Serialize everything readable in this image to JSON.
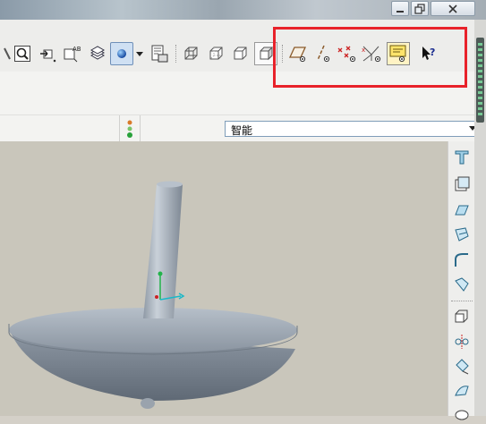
{
  "window": {
    "title": "",
    "controls": [
      "minimize",
      "restore",
      "close"
    ]
  },
  "main_toolbar": {
    "tools": [
      {
        "id": "partial-tool",
        "icon": "tool-icon"
      },
      {
        "id": "zoom",
        "icon": "magnifier-icon"
      },
      {
        "id": "spin-center",
        "icon": "spin-icon"
      },
      {
        "id": "saved-views",
        "icon": "saved-views-icon"
      },
      {
        "id": "layers",
        "icon": "layers-icon"
      },
      {
        "id": "display-style",
        "icon": "shaded-sphere-icon"
      },
      {
        "id": "view-manager",
        "icon": "view-manager-icon"
      },
      {
        "id": "view-wireframe",
        "icon": "wireframe-cube-icon"
      },
      {
        "id": "view-hidden",
        "icon": "hidden-line-cube-icon"
      },
      {
        "id": "view-no-hidden",
        "icon": "no-hidden-cube-icon"
      },
      {
        "id": "view-shaded",
        "icon": "shaded-cube-icon"
      },
      {
        "id": "datum-planes",
        "icon": "datum-plane-icon"
      },
      {
        "id": "datum-axes",
        "icon": "datum-axis-icon"
      },
      {
        "id": "datum-points",
        "icon": "datum-point-icon"
      },
      {
        "id": "coordinate-systems",
        "icon": "coordinate-system-icon"
      },
      {
        "id": "annotations",
        "icon": "annotation-icon"
      },
      {
        "id": "context-help",
        "icon": "help-arrow-icon"
      }
    ]
  },
  "selection_filter": {
    "value": "智能"
  },
  "status": {
    "indicator_icon": "traffic-light-icon"
  },
  "right_toolbar": {
    "tools": [
      "extrude-icon",
      "shell-icon",
      "draft-icon",
      "round-icon",
      "chamfer-icon",
      "edge-icon",
      "pattern-icon",
      "mirror-icon",
      "move-icon",
      "warp-icon",
      "sweep-icon"
    ]
  },
  "colors": {
    "highlight": "#e8222a",
    "viewport_bg": "#c9c6bb",
    "model": "#a9b3be"
  }
}
